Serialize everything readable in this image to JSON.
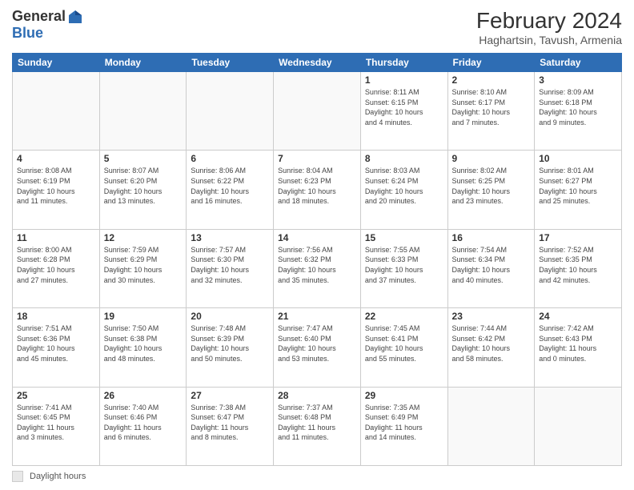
{
  "header": {
    "logo_general": "General",
    "logo_blue": "Blue",
    "month_year": "February 2024",
    "location": "Haghartsin, Tavush, Armenia"
  },
  "days_of_week": [
    "Sunday",
    "Monday",
    "Tuesday",
    "Wednesday",
    "Thursday",
    "Friday",
    "Saturday"
  ],
  "weeks": [
    [
      {
        "day": "",
        "info": ""
      },
      {
        "day": "",
        "info": ""
      },
      {
        "day": "",
        "info": ""
      },
      {
        "day": "",
        "info": ""
      },
      {
        "day": "1",
        "info": "Sunrise: 8:11 AM\nSunset: 6:15 PM\nDaylight: 10 hours\nand 4 minutes."
      },
      {
        "day": "2",
        "info": "Sunrise: 8:10 AM\nSunset: 6:17 PM\nDaylight: 10 hours\nand 7 minutes."
      },
      {
        "day": "3",
        "info": "Sunrise: 8:09 AM\nSunset: 6:18 PM\nDaylight: 10 hours\nand 9 minutes."
      }
    ],
    [
      {
        "day": "4",
        "info": "Sunrise: 8:08 AM\nSunset: 6:19 PM\nDaylight: 10 hours\nand 11 minutes."
      },
      {
        "day": "5",
        "info": "Sunrise: 8:07 AM\nSunset: 6:20 PM\nDaylight: 10 hours\nand 13 minutes."
      },
      {
        "day": "6",
        "info": "Sunrise: 8:06 AM\nSunset: 6:22 PM\nDaylight: 10 hours\nand 16 minutes."
      },
      {
        "day": "7",
        "info": "Sunrise: 8:04 AM\nSunset: 6:23 PM\nDaylight: 10 hours\nand 18 minutes."
      },
      {
        "day": "8",
        "info": "Sunrise: 8:03 AM\nSunset: 6:24 PM\nDaylight: 10 hours\nand 20 minutes."
      },
      {
        "day": "9",
        "info": "Sunrise: 8:02 AM\nSunset: 6:25 PM\nDaylight: 10 hours\nand 23 minutes."
      },
      {
        "day": "10",
        "info": "Sunrise: 8:01 AM\nSunset: 6:27 PM\nDaylight: 10 hours\nand 25 minutes."
      }
    ],
    [
      {
        "day": "11",
        "info": "Sunrise: 8:00 AM\nSunset: 6:28 PM\nDaylight: 10 hours\nand 27 minutes."
      },
      {
        "day": "12",
        "info": "Sunrise: 7:59 AM\nSunset: 6:29 PM\nDaylight: 10 hours\nand 30 minutes."
      },
      {
        "day": "13",
        "info": "Sunrise: 7:57 AM\nSunset: 6:30 PM\nDaylight: 10 hours\nand 32 minutes."
      },
      {
        "day": "14",
        "info": "Sunrise: 7:56 AM\nSunset: 6:32 PM\nDaylight: 10 hours\nand 35 minutes."
      },
      {
        "day": "15",
        "info": "Sunrise: 7:55 AM\nSunset: 6:33 PM\nDaylight: 10 hours\nand 37 minutes."
      },
      {
        "day": "16",
        "info": "Sunrise: 7:54 AM\nSunset: 6:34 PM\nDaylight: 10 hours\nand 40 minutes."
      },
      {
        "day": "17",
        "info": "Sunrise: 7:52 AM\nSunset: 6:35 PM\nDaylight: 10 hours\nand 42 minutes."
      }
    ],
    [
      {
        "day": "18",
        "info": "Sunrise: 7:51 AM\nSunset: 6:36 PM\nDaylight: 10 hours\nand 45 minutes."
      },
      {
        "day": "19",
        "info": "Sunrise: 7:50 AM\nSunset: 6:38 PM\nDaylight: 10 hours\nand 48 minutes."
      },
      {
        "day": "20",
        "info": "Sunrise: 7:48 AM\nSunset: 6:39 PM\nDaylight: 10 hours\nand 50 minutes."
      },
      {
        "day": "21",
        "info": "Sunrise: 7:47 AM\nSunset: 6:40 PM\nDaylight: 10 hours\nand 53 minutes."
      },
      {
        "day": "22",
        "info": "Sunrise: 7:45 AM\nSunset: 6:41 PM\nDaylight: 10 hours\nand 55 minutes."
      },
      {
        "day": "23",
        "info": "Sunrise: 7:44 AM\nSunset: 6:42 PM\nDaylight: 10 hours\nand 58 minutes."
      },
      {
        "day": "24",
        "info": "Sunrise: 7:42 AM\nSunset: 6:43 PM\nDaylight: 11 hours\nand 0 minutes."
      }
    ],
    [
      {
        "day": "25",
        "info": "Sunrise: 7:41 AM\nSunset: 6:45 PM\nDaylight: 11 hours\nand 3 minutes."
      },
      {
        "day": "26",
        "info": "Sunrise: 7:40 AM\nSunset: 6:46 PM\nDaylight: 11 hours\nand 6 minutes."
      },
      {
        "day": "27",
        "info": "Sunrise: 7:38 AM\nSunset: 6:47 PM\nDaylight: 11 hours\nand 8 minutes."
      },
      {
        "day": "28",
        "info": "Sunrise: 7:37 AM\nSunset: 6:48 PM\nDaylight: 11 hours\nand 11 minutes."
      },
      {
        "day": "29",
        "info": "Sunrise: 7:35 AM\nSunset: 6:49 PM\nDaylight: 11 hours\nand 14 minutes."
      },
      {
        "day": "",
        "info": ""
      },
      {
        "day": "",
        "info": ""
      }
    ]
  ],
  "footer": {
    "box_label": "Daylight hours"
  }
}
